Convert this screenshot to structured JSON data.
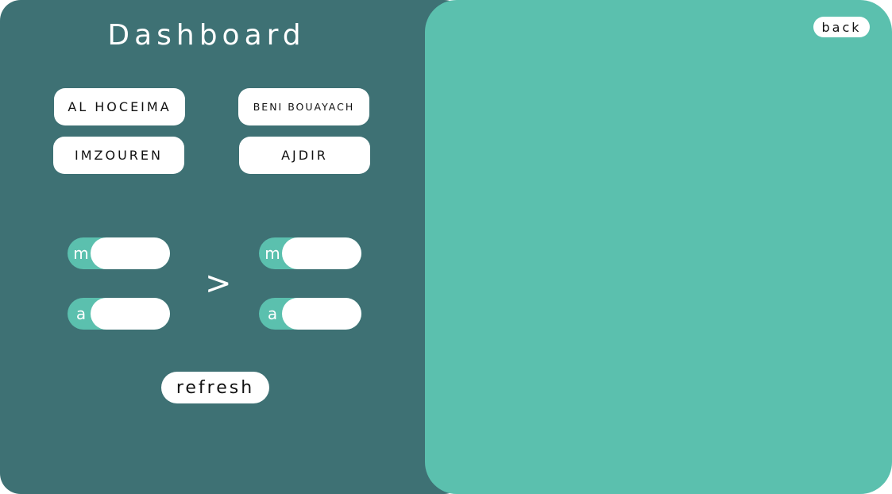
{
  "dashboard": {
    "title": "Dashboard",
    "cities": [
      {
        "label": "AL HOCEIMA"
      },
      {
        "label": "BENI BOUAYACH"
      },
      {
        "label": "IMZOUREN"
      },
      {
        "label": "AJDIR"
      }
    ],
    "range": {
      "from": {
        "month_label": "m",
        "month_value": "",
        "year_label": "a",
        "year_value": ""
      },
      "to": {
        "month_label": "m",
        "month_value": "",
        "year_label": "a",
        "year_value": ""
      },
      "separator": ">"
    },
    "refresh_label": "refresh"
  },
  "display": {
    "back_label": "back"
  },
  "colors": {
    "left_panel": "#3e7174",
    "accent": "#5bc0ae",
    "button_bg": "#ffffff"
  }
}
